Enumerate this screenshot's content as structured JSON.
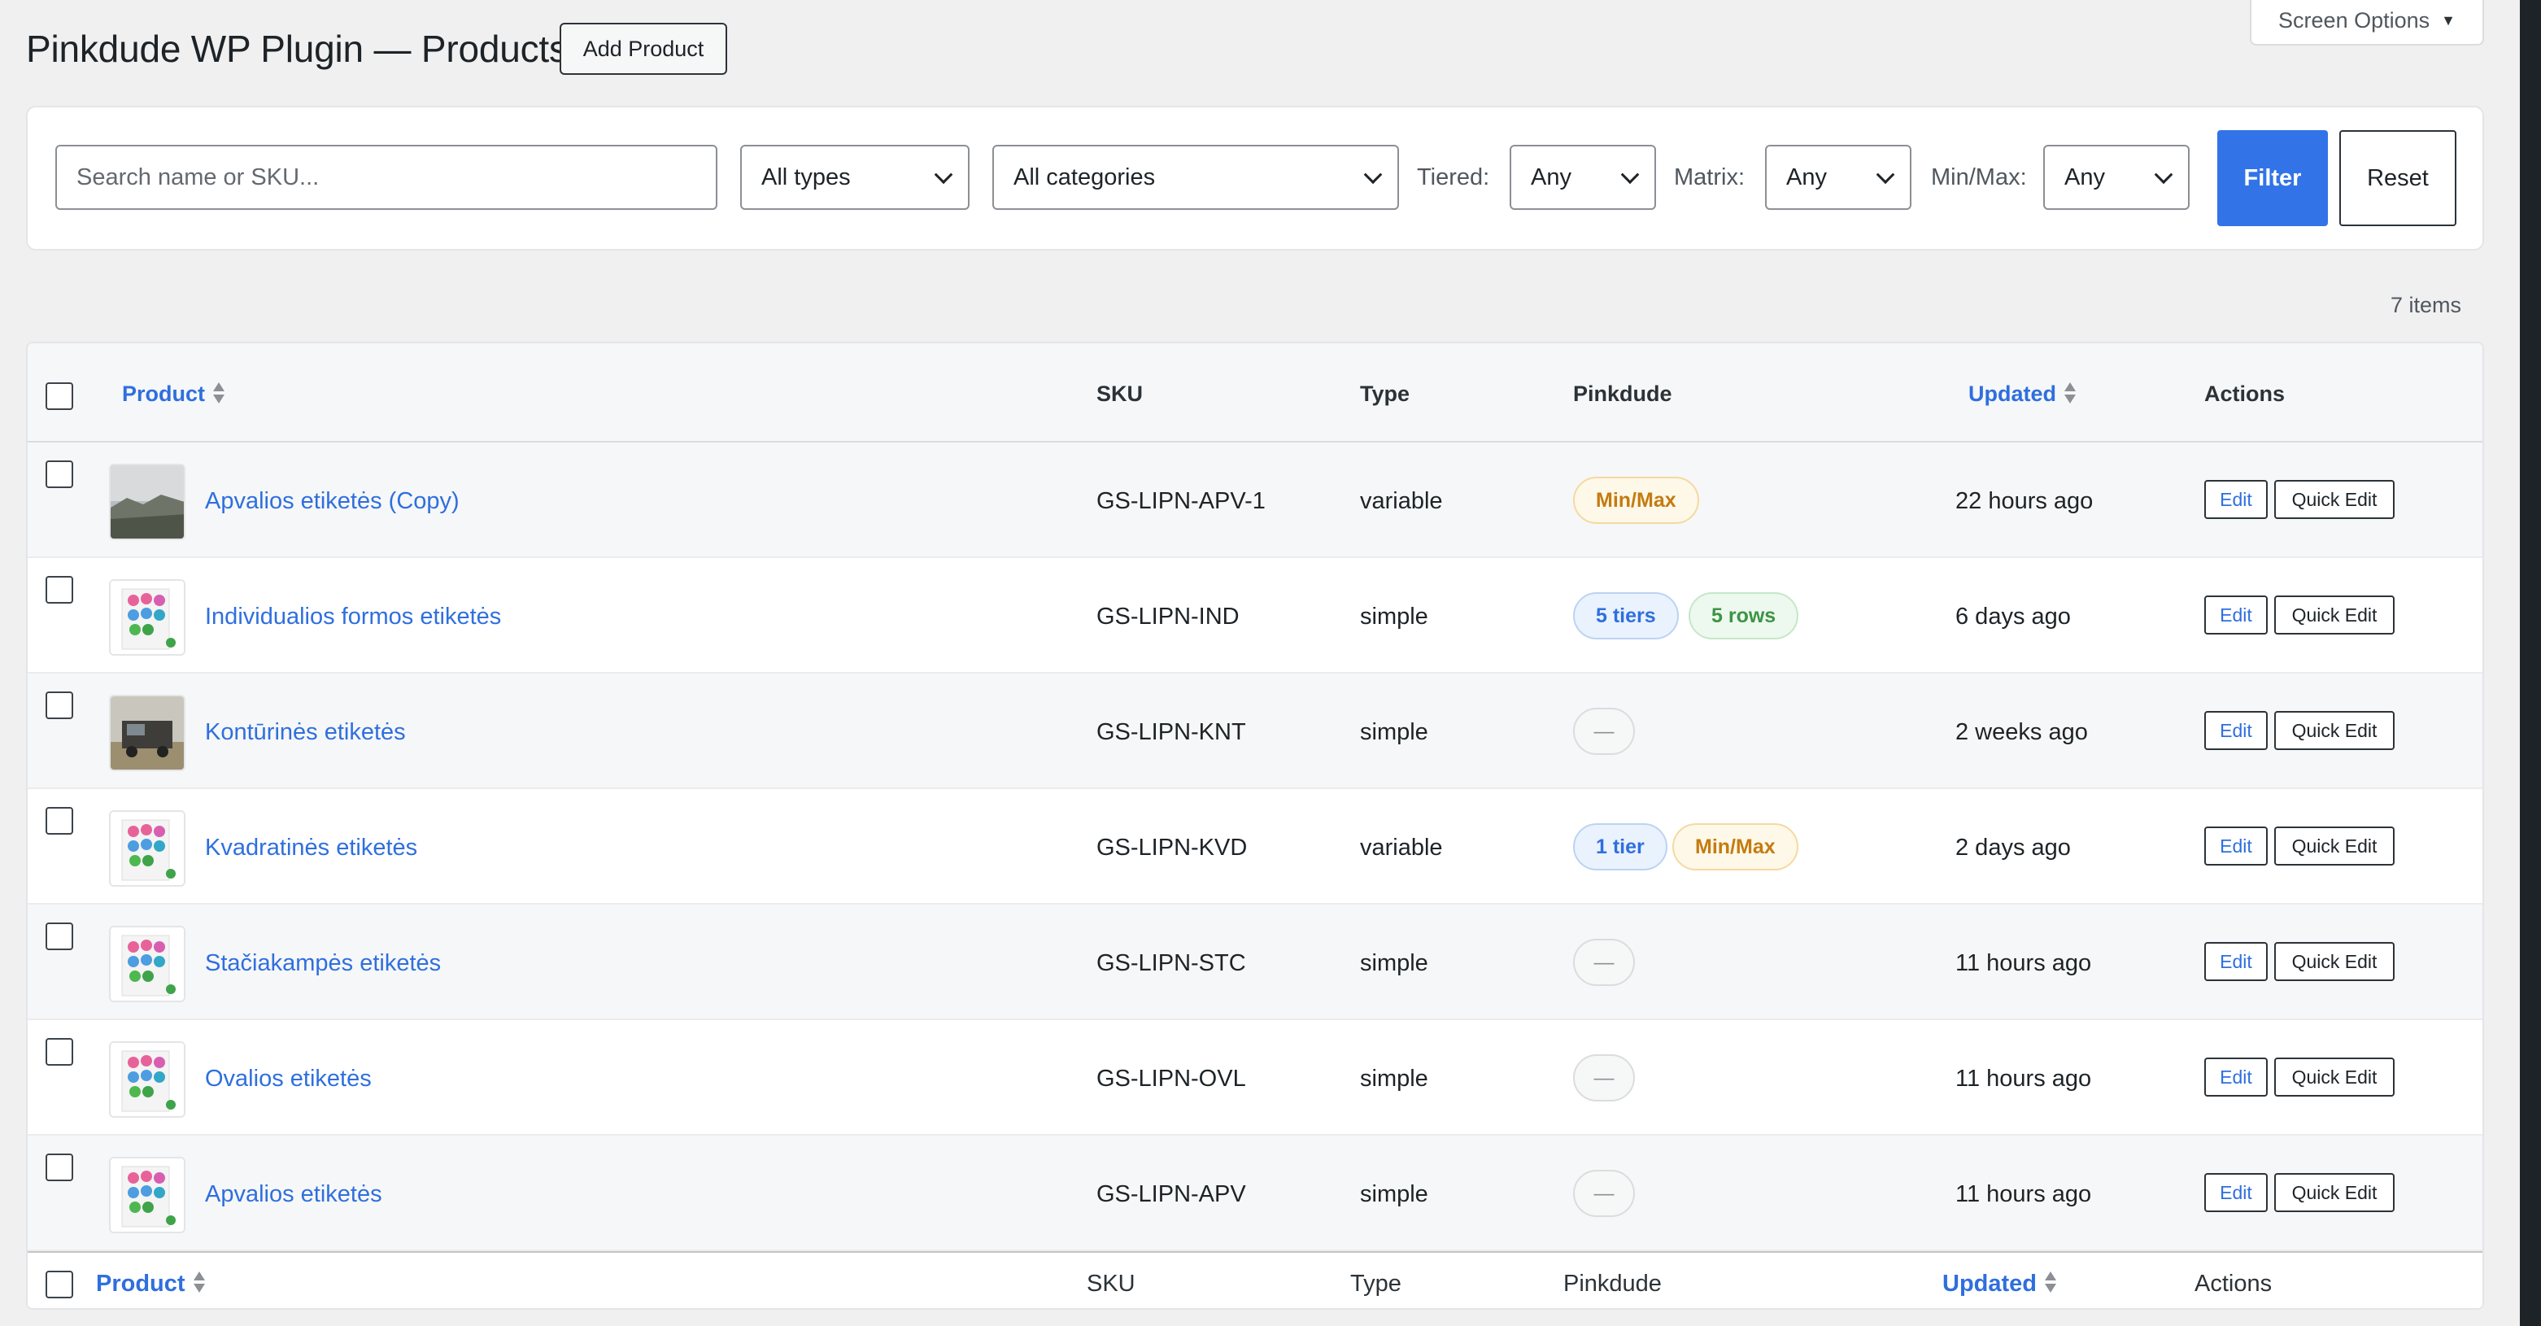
{
  "header": {
    "title": "Pinkdude WP Plugin — Products",
    "add_product": "Add Product",
    "screen_options": "Screen Options"
  },
  "filters": {
    "search_placeholder": "Search name or SKU...",
    "types": "All types",
    "categories": "All categories",
    "tiered_label": "Tiered:",
    "tiered_value": "Any",
    "matrix_label": "Matrix:",
    "matrix_value": "Any",
    "minmax_label": "Min/Max:",
    "minmax_value": "Any",
    "filter_btn": "Filter",
    "reset_btn": "Reset"
  },
  "items_count": "7 items",
  "columns": {
    "product": "Product",
    "sku": "SKU",
    "type": "Type",
    "pinkdude": "Pinkdude",
    "updated": "Updated",
    "actions": "Actions"
  },
  "row_actions": {
    "edit": "Edit",
    "quick_edit": "Quick Edit"
  },
  "rows": [
    {
      "name": "Apvalios etiketės (Copy)",
      "sku": "GS-LIPN-APV-1",
      "type": "variable",
      "badges": [
        "Min/Max"
      ],
      "updated": "22 hours ago",
      "thumb": "landscape-photo"
    },
    {
      "name": "Individualios formos etiketės",
      "sku": "GS-LIPN-IND",
      "type": "simple",
      "badges": [
        "5 tiers",
        "5 rows"
      ],
      "updated": "6 days ago",
      "thumb": "sticker-sheet"
    },
    {
      "name": "Kontūrinės etiketės",
      "sku": "GS-LIPN-KNT",
      "type": "simple",
      "badges": [
        "—"
      ],
      "updated": "2 weeks ago",
      "thumb": "truck-photo"
    },
    {
      "name": "Kvadratinės etiketės",
      "sku": "GS-LIPN-KVD",
      "type": "variable",
      "badges": [
        "1 tier",
        "Min/Max"
      ],
      "updated": "2 days ago",
      "thumb": "sticker-sheet"
    },
    {
      "name": "Stačiakampės etiketės",
      "sku": "GS-LIPN-STC",
      "type": "simple",
      "badges": [
        "—"
      ],
      "updated": "11 hours ago",
      "thumb": "sticker-sheet"
    },
    {
      "name": "Ovalios etiketės",
      "sku": "GS-LIPN-OVL",
      "type": "simple",
      "badges": [
        "—"
      ],
      "updated": "11 hours ago",
      "thumb": "sticker-sheet"
    },
    {
      "name": "Apvalios etiketės",
      "sku": "GS-LIPN-APV",
      "type": "simple",
      "badges": [
        "—"
      ],
      "updated": "11 hours ago",
      "thumb": "sticker-sheet"
    }
  ],
  "colors": {
    "link": "#2f6fde",
    "primary_button": "#3273e8",
    "minmax_badge": "#c47b10",
    "tier_badge": "#2f6fde",
    "rows_badge": "#3d9446"
  }
}
